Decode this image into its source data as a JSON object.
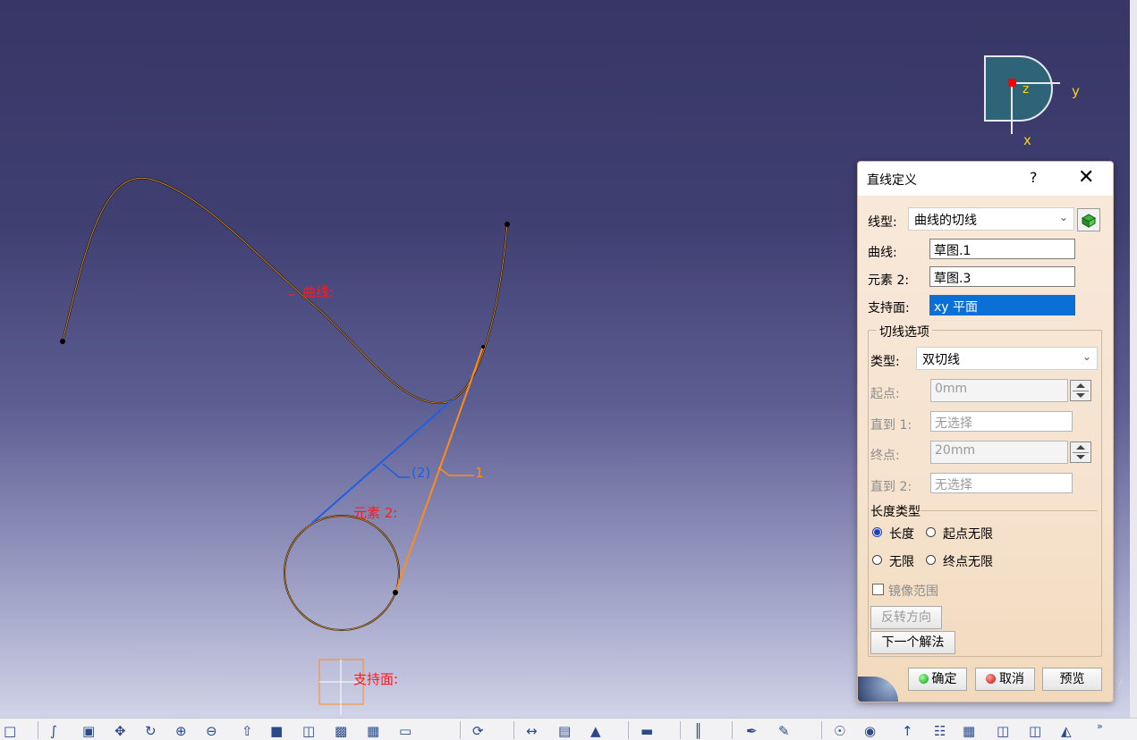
{
  "compass": {
    "z": "z",
    "y": "y",
    "x": "x"
  },
  "viewport_labels": {
    "curve": "曲线:",
    "element2": "元素 2:",
    "support": "支持面:",
    "sol2": "(2)",
    "sol1": "1"
  },
  "corner_text": {
    "y": "y",
    "x": "x"
  },
  "dialog": {
    "title": "直线定义",
    "help": "?",
    "close": "✕",
    "line_type_label": "线型:",
    "line_type_value": "曲线的切线",
    "curve_label": "曲线:",
    "curve_value": "草图.1",
    "element2_label": "元素 2:",
    "element2_value": "草图.3",
    "support_label": "支持面:",
    "support_value": "xy 平面",
    "tangent_group_title": "切线选项",
    "type_label": "类型:",
    "type_value": "双切线",
    "start_label": "起点:",
    "start_value": "0mm",
    "upto1_label": "直到 1:",
    "upto1_value": "无选择",
    "end_label": "终点:",
    "end_value": "20mm",
    "upto2_label": "直到 2:",
    "upto2_value": "无选择",
    "length_type_title": "长度类型",
    "radio_length": "长度",
    "radio_start_infinite": "起点无限",
    "radio_infinite": "无限",
    "radio_end_infinite": "终点无限",
    "mirror_label": "镜像范围",
    "reverse_button": "反转方向",
    "next_solution_button": "下一个解法",
    "ok_button": "确定",
    "cancel_button": "取消",
    "preview_button": "预览"
  },
  "colors": {
    "curve": "#c47a19",
    "orange_line": "#ff8c1a",
    "blue_line": "#1f5fe0",
    "label_red": "#ff1a1a"
  }
}
